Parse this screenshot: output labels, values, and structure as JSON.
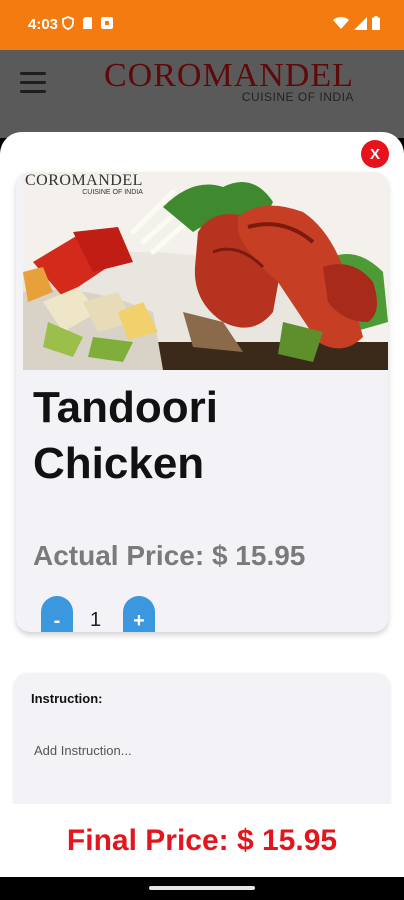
{
  "status_bar": {
    "time": "4:03",
    "icons": [
      "shield-icon",
      "sd-card-icon",
      "media-icon",
      "wifi-icon",
      "signal-icon",
      "battery-icon"
    ]
  },
  "header": {
    "menu_icon": "hamburger-menu-icon",
    "brand_name": "COROMANDEL",
    "brand_tagline": "CUISINE OF INDIA"
  },
  "dialog": {
    "close_label": "X",
    "product": {
      "image_logo_name": "COROMANDEL",
      "image_logo_tagline": "CUISINE OF INDIA",
      "name": "Tandoori Chicken",
      "actual_price": "Actual Price: $ 15.95",
      "quantity": "1",
      "decrement_label": "-",
      "increment_label": "+"
    },
    "instruction": {
      "label": "Instruction:",
      "placeholder": "Add Instruction..."
    },
    "final_price": "Final Price: $ 15.95"
  },
  "colors": {
    "status_bar": "#F47B0F",
    "header_bg": "#5a5a5a",
    "brand": "#5e0a0a",
    "close_button": "#e8121b",
    "qty_button": "#3b97de",
    "final_price": "#e3161d"
  }
}
